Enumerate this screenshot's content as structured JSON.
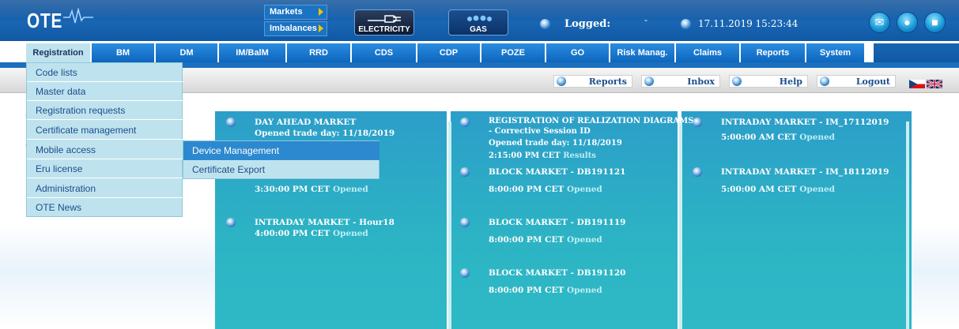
{
  "header": {
    "logo_text": "OTE",
    "markets_label": "Markets",
    "imbalances_label": "Imbalances",
    "electricity_label": "ELECTRICITY",
    "gas_label": "GAS",
    "logged_label": "Logged:",
    "logged_user": "-",
    "datetime": "17.11.2019 15:23:44"
  },
  "nav": {
    "items": [
      "Registration",
      "BM",
      "DM",
      "IM/BalM",
      "RRD",
      "CDS",
      "CDP",
      "POZE",
      "GO",
      "Risk Manag.",
      "Claims",
      "Reports",
      "System"
    ]
  },
  "subbar": {
    "reports": "Reports",
    "inbox": "Inbox",
    "help": "Help",
    "logout": "Logout"
  },
  "menu": {
    "items": [
      "Code lists",
      "Master data",
      "Registration requests",
      "Certificate management",
      "Mobile access",
      "Eru license",
      "Administration",
      "OTE News"
    ],
    "submenu": [
      "Device Management",
      "Certificate Export"
    ]
  },
  "panel1": {
    "e1_title": "DAY AHEAD MARKET",
    "e1_line2": "Opened trade day: 11/18/2019",
    "e2_time": "3:30:00 PM CET",
    "e2_status": "Opened",
    "e3_title": "INTRADAY MARKET - Hour18",
    "e3_time": "4:00:00 PM CET",
    "e3_status": "Opened"
  },
  "panel2": {
    "e1_title": "REGISTRATION OF REALIZATION DIAGRAMS",
    "e1_sub": "- Corrective Session ID",
    "e1_line2": "Opened trade day: 11/18/2019",
    "e1_time": "2:15:00 PM CET",
    "e1_status": "Results",
    "e2_title": "BLOCK MARKET - DB191121",
    "e2_time": "8:00:00 PM CET",
    "e2_status": "Opened",
    "e3_title": "BLOCK MARKET - DB191119",
    "e3_time": "8:00:00 PM CET",
    "e3_status": "Opened",
    "e4_title": "BLOCK MARKET - DB191120",
    "e4_time": "8:00:00 PM CET",
    "e4_status": "Opened"
  },
  "panel3": {
    "e1_title": "INTRADAY MARKET - IM_17112019",
    "e1_time": "5:00:00 AM CET",
    "e1_status": "Opened",
    "e2_title": "INTRADAY MARKET - IM_18112019",
    "e2_time": "5:00:00 AM CET",
    "e2_status": "Opened"
  },
  "colors": {
    "nav_blue": "#0d66bd",
    "panel_teal": "#2cb4c4",
    "menu_bg": "#bfe3ee",
    "selected_blue": "#2c89cf"
  },
  "icons": [
    "mail-icon",
    "chat-icon",
    "windows-icon",
    "electricity-plug-icon",
    "gas-flame-icon"
  ]
}
